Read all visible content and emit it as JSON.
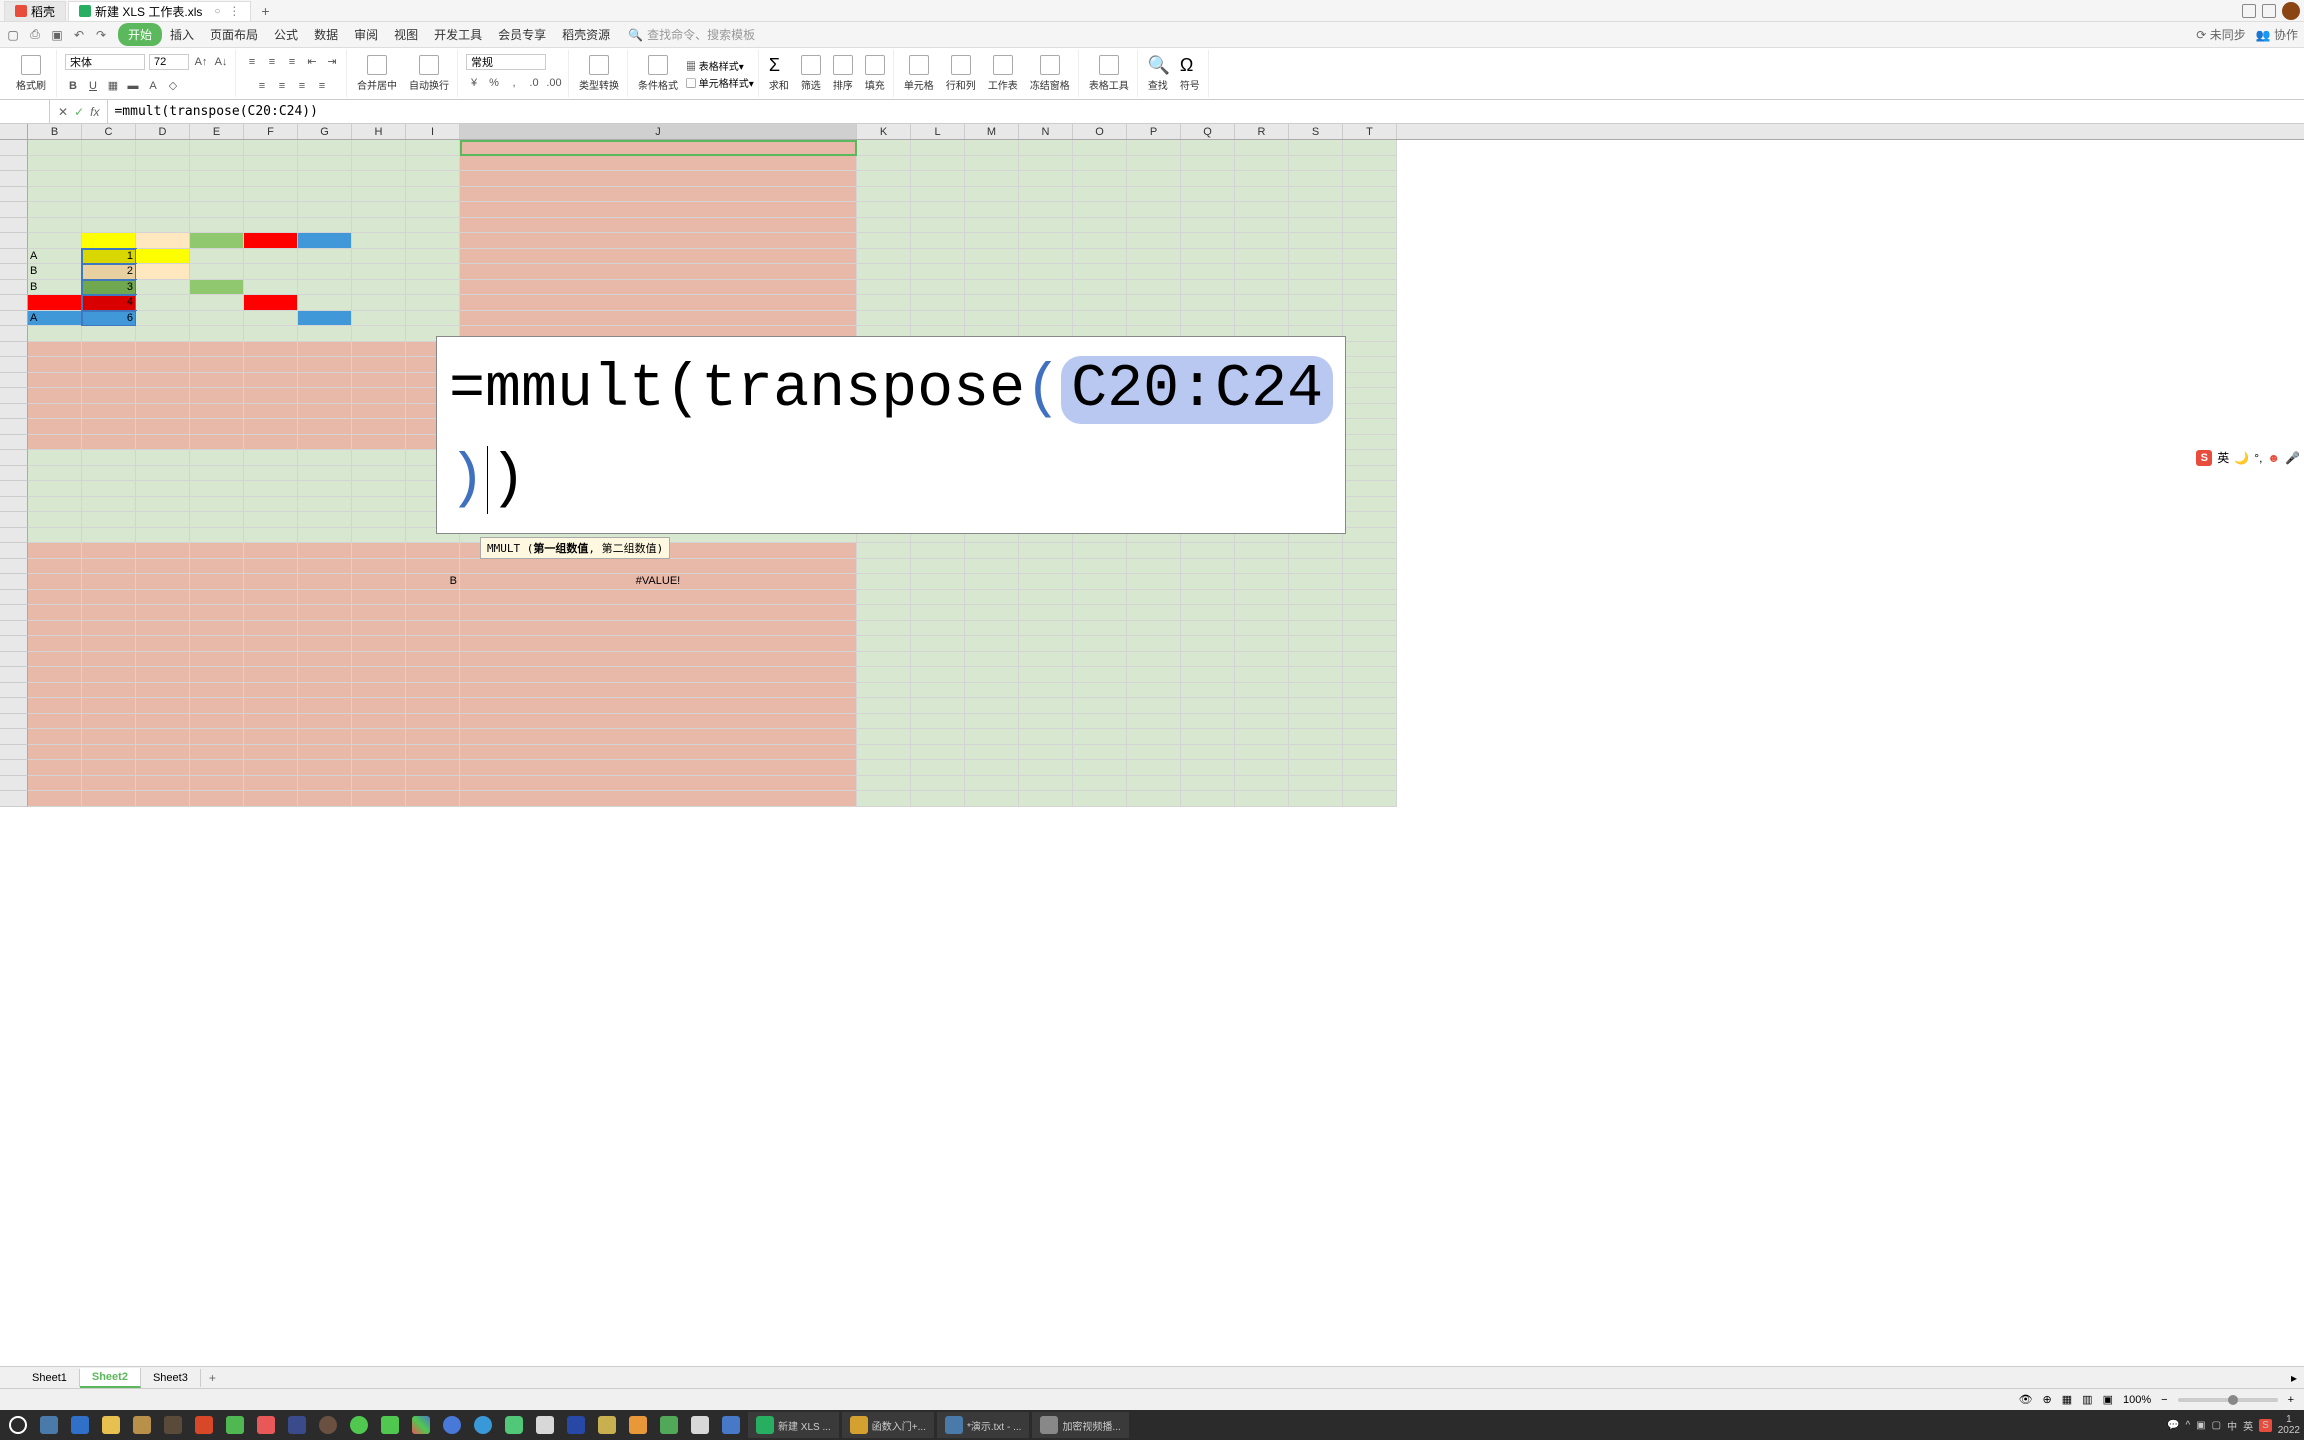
{
  "title_tabs": [
    {
      "label": "稻壳",
      "icon": "doke"
    },
    {
      "label": "新建 XLS 工作表.xls",
      "icon": "sheet",
      "active": true
    }
  ],
  "ribbon": {
    "tabs": [
      "开始",
      "插入",
      "页面布局",
      "公式",
      "数据",
      "审阅",
      "视图",
      "开发工具",
      "会员专享",
      "稻壳资源"
    ],
    "active_tab": "开始",
    "search_placeholder": "查找命令、搜索模板",
    "sync": "未同步",
    "collab": "协作"
  },
  "toolbar": {
    "format_painter": "格式刷",
    "font_name": "宋体",
    "font_size": "72",
    "number_format": "常规",
    "merge": "合并居中",
    "wrap": "自动换行",
    "type_convert": "类型转换",
    "cond_format": "条件格式",
    "table_style": "表格样式",
    "cell_style": "单元格样式",
    "sum": "求和",
    "filter": "筛选",
    "sort": "排序",
    "fill": "填充",
    "cell_format": "单元格",
    "row_col": "行和列",
    "worksheet": "工作表",
    "freeze": "冻结窗格",
    "table_tools": "表格工具",
    "find": "查找",
    "symbol": "符号"
  },
  "formula_bar": {
    "name_box": "",
    "formula": "=mmult(transpose(C20:C24))"
  },
  "columns": [
    "B",
    "C",
    "D",
    "E",
    "F",
    "G",
    "H",
    "I",
    "J",
    "K",
    "L",
    "M",
    "N",
    "O",
    "P",
    "Q",
    "R",
    "S",
    "T"
  ],
  "data_cells": {
    "row20": {
      "B": "A",
      "C": "1"
    },
    "row21": {
      "B": "B",
      "C": "2"
    },
    "row22": {
      "B": "B",
      "C": "3"
    },
    "row23": {
      "B": "",
      "C": "4"
    },
    "row24": {
      "B": "A",
      "C": "6"
    }
  },
  "labels": {
    "A_label": "A",
    "B_label": "B",
    "value_error": "#VALUE!"
  },
  "overlay_formula": {
    "eq": "=",
    "fn1": "mmult",
    "fn2": "transpose",
    "ref": "C20:C24"
  },
  "formula_hint": {
    "fn": "MMULT",
    "arg1": "第一组数值",
    "sep": ", ",
    "arg2": "第二组数值"
  },
  "ime": {
    "lang": "英"
  },
  "sheet_tabs": [
    "Sheet1",
    "Sheet2",
    "Sheet3"
  ],
  "active_sheet": "Sheet2",
  "status": {
    "zoom": "100%"
  },
  "taskbar": {
    "items": [
      {
        "label": "新建 XLS ...",
        "color": "#27ae60"
      },
      {
        "label": "函数入门+...",
        "color": "#d4a030"
      },
      {
        "label": "*演示.txt - ...",
        "color": "#4a7aaa"
      },
      {
        "label": "加密视频播...",
        "color": "#888"
      }
    ],
    "time": "1",
    "date": "2022"
  }
}
